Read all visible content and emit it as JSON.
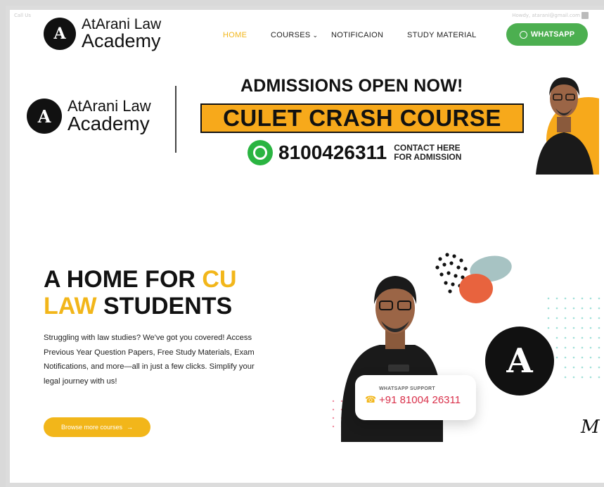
{
  "utility_bar": {
    "left_text": "Call Us",
    "right_text": "Howdy, atarani@gmail.com"
  },
  "brand": {
    "line1": "AtArani Law",
    "line2": "Academy",
    "badge_letter": "A"
  },
  "nav": {
    "home": "HOME",
    "courses": "COURSES",
    "notification": "NOTIFICAION",
    "study_material": "STUDY MATERIAL",
    "whatsapp_button": "WHATSAPP"
  },
  "banner": {
    "brand_line1": "AtArani Law",
    "brand_line2": "Academy",
    "headline": "ADMISSIONS OPEN NOW!",
    "course": "CULET CRASH COURSE",
    "phone": "8100426311",
    "contact_line1": "CONTACT HERE",
    "contact_line2": "FOR ADMISSION"
  },
  "hero": {
    "title_part1": "A HOME FOR ",
    "title_accent1": "CU",
    "title_accent2": "LAW",
    "title_part2": " STUDENTS",
    "description": "Struggling with law studies? We've got you covered! Access Previous Year Question Papers, Free Study Materials, Exam Notifications, and more—all in just a few clicks. Simplify your legal journey with us!",
    "cta": "Browse more courses",
    "cta_arrow": "→"
  },
  "whatsapp_card": {
    "label": "WHATSAPP SUPPORT",
    "number": "+91 81004 26311"
  },
  "signature": "M",
  "colors": {
    "accent": "#f2b61a",
    "whatsapp": "#4caf50",
    "banner_orange": "#f7a91b",
    "support_red": "#d9304a"
  }
}
